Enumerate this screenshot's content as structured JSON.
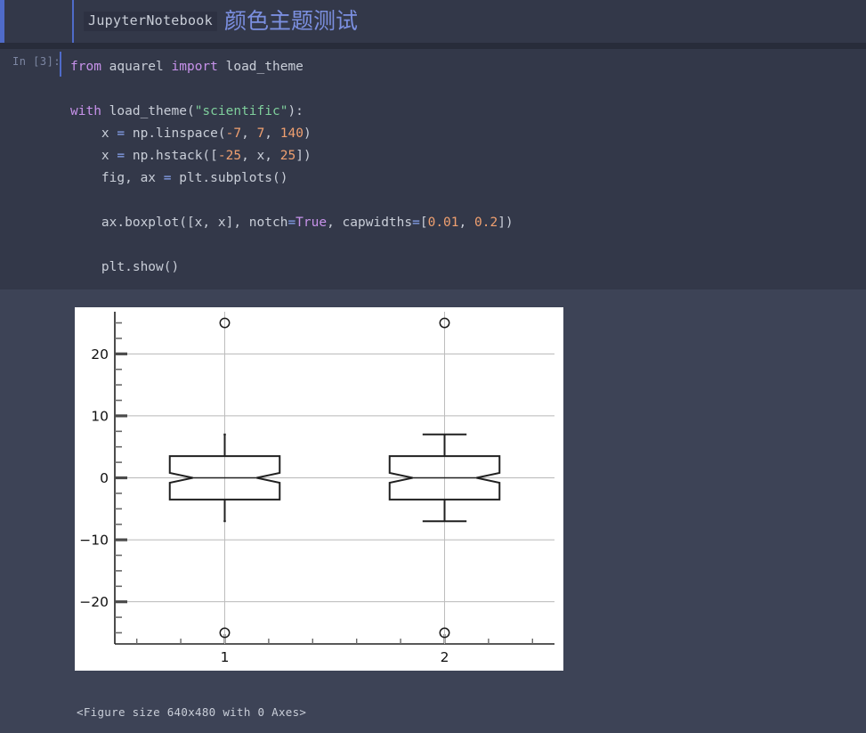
{
  "header": {
    "badge": "JupyterNotebook",
    "title": "颜色主题测试",
    "accent_color": "#4f6bc9",
    "title_color": "#7b8fe0",
    "background": "#333849"
  },
  "cell": {
    "prompt": "In [3]:",
    "code_lines": [
      {
        "tokens": [
          {
            "t": "from ",
            "c": "kw"
          },
          {
            "t": "aquarel ",
            "c": "plain"
          },
          {
            "t": "import ",
            "c": "kw"
          },
          {
            "t": "load_theme",
            "c": "plain"
          }
        ]
      },
      {
        "tokens": []
      },
      {
        "tokens": [
          {
            "t": "with ",
            "c": "kw"
          },
          {
            "t": "load_theme(",
            "c": "plain"
          },
          {
            "t": "\"scientific\"",
            "c": "str"
          },
          {
            "t": "):",
            "c": "plain"
          }
        ]
      },
      {
        "tokens": [
          {
            "t": "    x ",
            "c": "plain"
          },
          {
            "t": "= ",
            "c": "op"
          },
          {
            "t": "np.linspace(",
            "c": "plain"
          },
          {
            "t": "-7",
            "c": "num"
          },
          {
            "t": ", ",
            "c": "plain"
          },
          {
            "t": "7",
            "c": "num"
          },
          {
            "t": ", ",
            "c": "plain"
          },
          {
            "t": "140",
            "c": "num"
          },
          {
            "t": ")",
            "c": "plain"
          }
        ]
      },
      {
        "tokens": [
          {
            "t": "    x ",
            "c": "plain"
          },
          {
            "t": "= ",
            "c": "op"
          },
          {
            "t": "np.hstack([",
            "c": "plain"
          },
          {
            "t": "-25",
            "c": "num"
          },
          {
            "t": ", x, ",
            "c": "plain"
          },
          {
            "t": "25",
            "c": "num"
          },
          {
            "t": "])",
            "c": "plain"
          }
        ]
      },
      {
        "tokens": [
          {
            "t": "    fig, ax ",
            "c": "plain"
          },
          {
            "t": "= ",
            "c": "op"
          },
          {
            "t": "plt.subplots()",
            "c": "plain"
          }
        ]
      },
      {
        "tokens": []
      },
      {
        "tokens": [
          {
            "t": "    ax.boxplot([x, x], notch",
            "c": "plain"
          },
          {
            "t": "=",
            "c": "op"
          },
          {
            "t": "True",
            "c": "bool"
          },
          {
            "t": ", capwidths",
            "c": "plain"
          },
          {
            "t": "=",
            "c": "op"
          },
          {
            "t": "[",
            "c": "plain"
          },
          {
            "t": "0.01",
            "c": "num"
          },
          {
            "t": ", ",
            "c": "plain"
          },
          {
            "t": "0.2",
            "c": "num"
          },
          {
            "t": "])",
            "c": "plain"
          }
        ]
      },
      {
        "tokens": []
      },
      {
        "tokens": [
          {
            "t": "    plt.show()",
            "c": "plain"
          }
        ]
      }
    ]
  },
  "output": {
    "stdout": "<Figure size 640x480 with 0 Axes>"
  },
  "chart_data": {
    "type": "box",
    "title": "",
    "xlabel": "",
    "ylabel": "",
    "xtick_labels": [
      "1",
      "2"
    ],
    "ytick_labels": [
      "20",
      "10",
      "0",
      "−10",
      "−20"
    ],
    "ytick_values": [
      20,
      10,
      0,
      -10,
      -20
    ],
    "ylim": [
      -26.8,
      26.8
    ],
    "xlim": [
      0.5,
      2.5
    ],
    "y_minor_ticks": [
      25,
      22.5,
      17.5,
      15,
      12.5,
      7.5,
      5,
      2.5,
      -2.5,
      -5,
      -7.5,
      -12.5,
      -15,
      -17.5,
      -22.5,
      -25
    ],
    "grid": "y-only",
    "grid_color": "#b8b8b8",
    "spine_color": "#202020",
    "box_edge_color": "#202020",
    "figure_facecolor": "#ffffff",
    "legend": "none",
    "series": [
      {
        "name": "1",
        "position": 1,
        "capwidth": 0.01,
        "q1": -3.5,
        "median": 0.0,
        "q3": 3.5,
        "whisker_low": -7.0,
        "whisker_high": 7.0,
        "notch_low": -0.8,
        "notch_high": 0.8,
        "outliers": [
          25,
          -25
        ]
      },
      {
        "name": "2",
        "position": 2,
        "capwidth": 0.2,
        "q1": -3.5,
        "median": 0.0,
        "q3": 3.5,
        "whisker_low": -7.0,
        "whisker_high": 7.0,
        "notch_low": -0.8,
        "notch_high": 0.8,
        "outliers": [
          25,
          -25
        ]
      }
    ]
  }
}
